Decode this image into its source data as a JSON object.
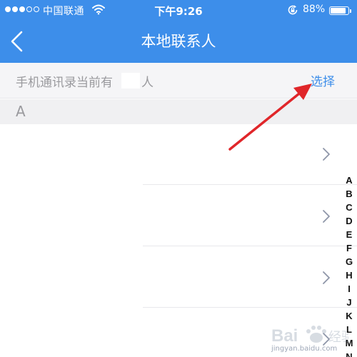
{
  "status_bar": {
    "carrier": "中国联通",
    "time": "下午9:26",
    "battery_percent": "88%",
    "battery_level": 0.88,
    "signal_bars_filled": 3,
    "signal_bars_total": 5
  },
  "nav": {
    "title": "本地联系人"
  },
  "info_row": {
    "text": "手机通讯录当前有",
    "suffix": "人",
    "select_label": "选择"
  },
  "section": {
    "letter": "A"
  },
  "contacts_visible": 4,
  "alphabet_index": [
    "A",
    "B",
    "C",
    "D",
    "E",
    "F",
    "G",
    "H",
    "I",
    "J",
    "K",
    "L",
    "M",
    "N"
  ],
  "colors": {
    "header": "#3d8eea",
    "link": "#3d8eea",
    "annotation_arrow": "#e0262a"
  },
  "watermark": {
    "text": "Baidu 经验",
    "url": "jingyan.baidu.com"
  }
}
